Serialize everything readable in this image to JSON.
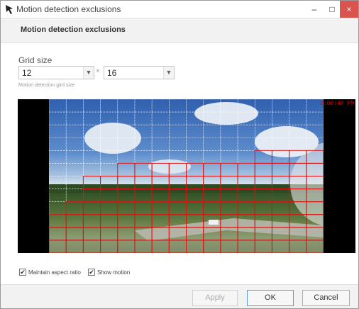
{
  "window": {
    "title": "Motion detection exclusions",
    "minimize_label": "–",
    "maximize_label": "□",
    "close_label": "×"
  },
  "header": {
    "title": "Motion detection exclusions"
  },
  "grid": {
    "label": "Grid size",
    "rows": 12,
    "cols": 16,
    "separator": "×",
    "hint": "Motion detection gird size",
    "grid_color": "#ffffff",
    "excluded_color": "#e01010",
    "excluded_cells": [
      [
        4,
        12
      ],
      [
        4,
        13
      ],
      [
        4,
        14
      ],
      [
        4,
        15
      ],
      [
        5,
        4
      ],
      [
        5,
        5
      ],
      [
        5,
        6
      ],
      [
        5,
        7
      ],
      [
        5,
        8
      ],
      [
        5,
        9
      ],
      [
        5,
        10
      ],
      [
        5,
        11
      ],
      [
        5,
        12
      ],
      [
        5,
        13
      ],
      [
        5,
        14
      ],
      [
        5,
        15
      ],
      [
        6,
        2
      ],
      [
        6,
        3
      ],
      [
        6,
        4
      ],
      [
        6,
        5
      ],
      [
        6,
        6
      ],
      [
        6,
        7
      ],
      [
        6,
        8
      ],
      [
        6,
        9
      ],
      [
        6,
        10
      ],
      [
        6,
        11
      ],
      [
        6,
        12
      ],
      [
        6,
        13
      ],
      [
        6,
        14
      ],
      [
        6,
        15
      ],
      [
        7,
        2
      ],
      [
        7,
        3
      ],
      [
        7,
        4
      ],
      [
        7,
        5
      ],
      [
        7,
        6
      ],
      [
        7,
        7
      ],
      [
        7,
        8
      ],
      [
        7,
        9
      ],
      [
        7,
        10
      ],
      [
        7,
        11
      ],
      [
        7,
        12
      ],
      [
        7,
        13
      ],
      [
        7,
        14
      ],
      [
        7,
        15
      ],
      [
        8,
        1
      ],
      [
        8,
        2
      ],
      [
        8,
        3
      ],
      [
        8,
        4
      ],
      [
        8,
        5
      ],
      [
        8,
        6
      ],
      [
        8,
        7
      ],
      [
        8,
        8
      ],
      [
        8,
        9
      ],
      [
        8,
        10
      ],
      [
        8,
        11
      ],
      [
        8,
        12
      ],
      [
        8,
        13
      ],
      [
        8,
        14
      ],
      [
        8,
        15
      ],
      [
        9,
        0
      ],
      [
        9,
        1
      ],
      [
        9,
        2
      ],
      [
        9,
        3
      ],
      [
        9,
        4
      ],
      [
        9,
        5
      ],
      [
        9,
        6
      ],
      [
        9,
        7
      ],
      [
        9,
        8
      ],
      [
        9,
        9
      ],
      [
        9,
        10
      ],
      [
        9,
        11
      ],
      [
        9,
        12
      ],
      [
        9,
        13
      ],
      [
        9,
        14
      ],
      [
        9,
        15
      ],
      [
        10,
        0
      ],
      [
        10,
        1
      ],
      [
        10,
        2
      ],
      [
        10,
        3
      ],
      [
        10,
        4
      ],
      [
        10,
        5
      ],
      [
        10,
        6
      ],
      [
        10,
        7
      ],
      [
        10,
        8
      ],
      [
        10,
        9
      ],
      [
        10,
        10
      ],
      [
        10,
        11
      ],
      [
        10,
        12
      ],
      [
        10,
        13
      ],
      [
        10,
        14
      ],
      [
        10,
        15
      ],
      [
        11,
        0
      ],
      [
        11,
        1
      ],
      [
        11,
        2
      ],
      [
        11,
        3
      ],
      [
        11,
        4
      ],
      [
        11,
        5
      ],
      [
        11,
        6
      ],
      [
        11,
        7
      ],
      [
        11,
        8
      ],
      [
        11,
        9
      ],
      [
        11,
        10
      ],
      [
        11,
        11
      ],
      [
        11,
        12
      ],
      [
        11,
        13
      ],
      [
        11,
        14
      ],
      [
        11,
        15
      ]
    ]
  },
  "preview": {
    "timestamp": "2:00:40 PM"
  },
  "options": {
    "maintain_aspect_label": "Maintain aspect ratio",
    "maintain_aspect_checked": true,
    "show_motion_label": "Show motion",
    "show_motion_checked": true,
    "check_glyph": "✔"
  },
  "buttons": {
    "apply": "Apply",
    "ok": "OK",
    "cancel": "Cancel"
  },
  "colors": {
    "close_button": "#d9534f",
    "accent": "#5b9bd5"
  }
}
